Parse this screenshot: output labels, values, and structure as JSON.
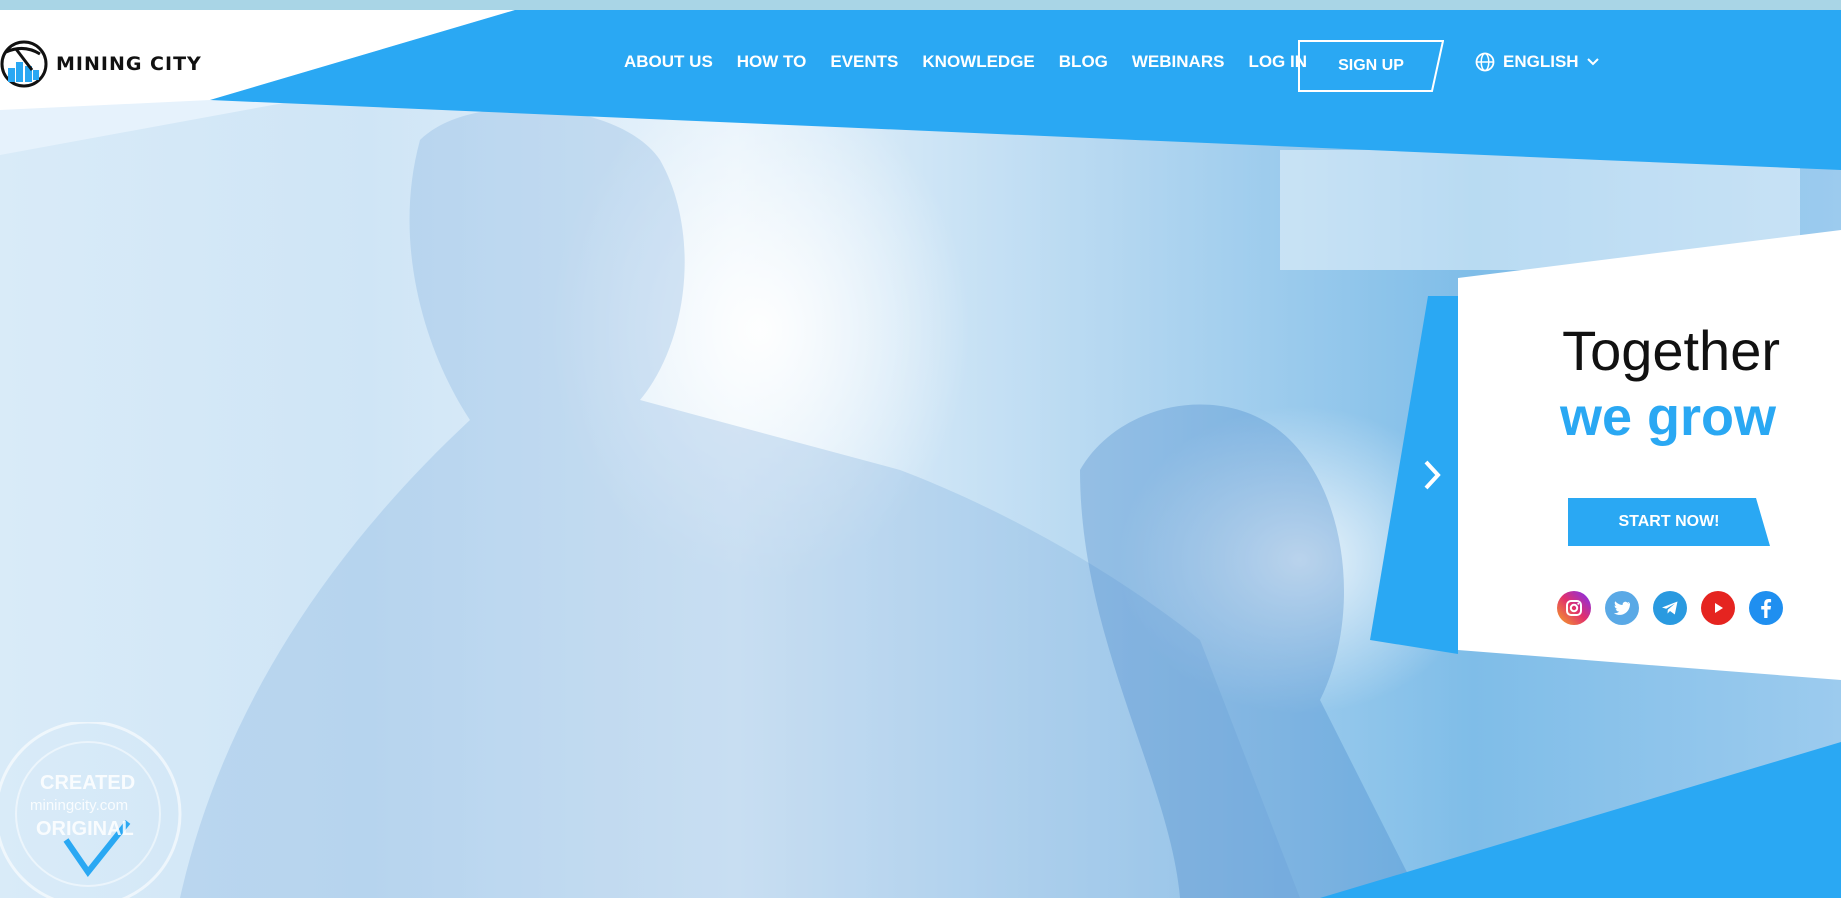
{
  "brand": {
    "name": "MINING CITY"
  },
  "nav": {
    "items": [
      "ABOUT US",
      "HOW TO",
      "EVENTS",
      "KNOWLEDGE",
      "BLOG",
      "WEBINARS",
      "LOG IN"
    ],
    "signup_label": "SIGN UP",
    "language_label": "ENGLISH"
  },
  "hero": {
    "title_line1": "Together",
    "title_line2": "we grow",
    "cta_label": "START NOW!",
    "social": [
      "instagram-icon",
      "twitter-icon",
      "telegram-icon",
      "youtube-icon",
      "facebook-icon"
    ]
  },
  "stamp": {
    "line1": "CREATED",
    "line2": "miningcity.com",
    "line3": "ORIGINAL"
  },
  "colors": {
    "accent": "#2aa8f3",
    "text_dark": "#111111",
    "youtube": "#e52420"
  }
}
